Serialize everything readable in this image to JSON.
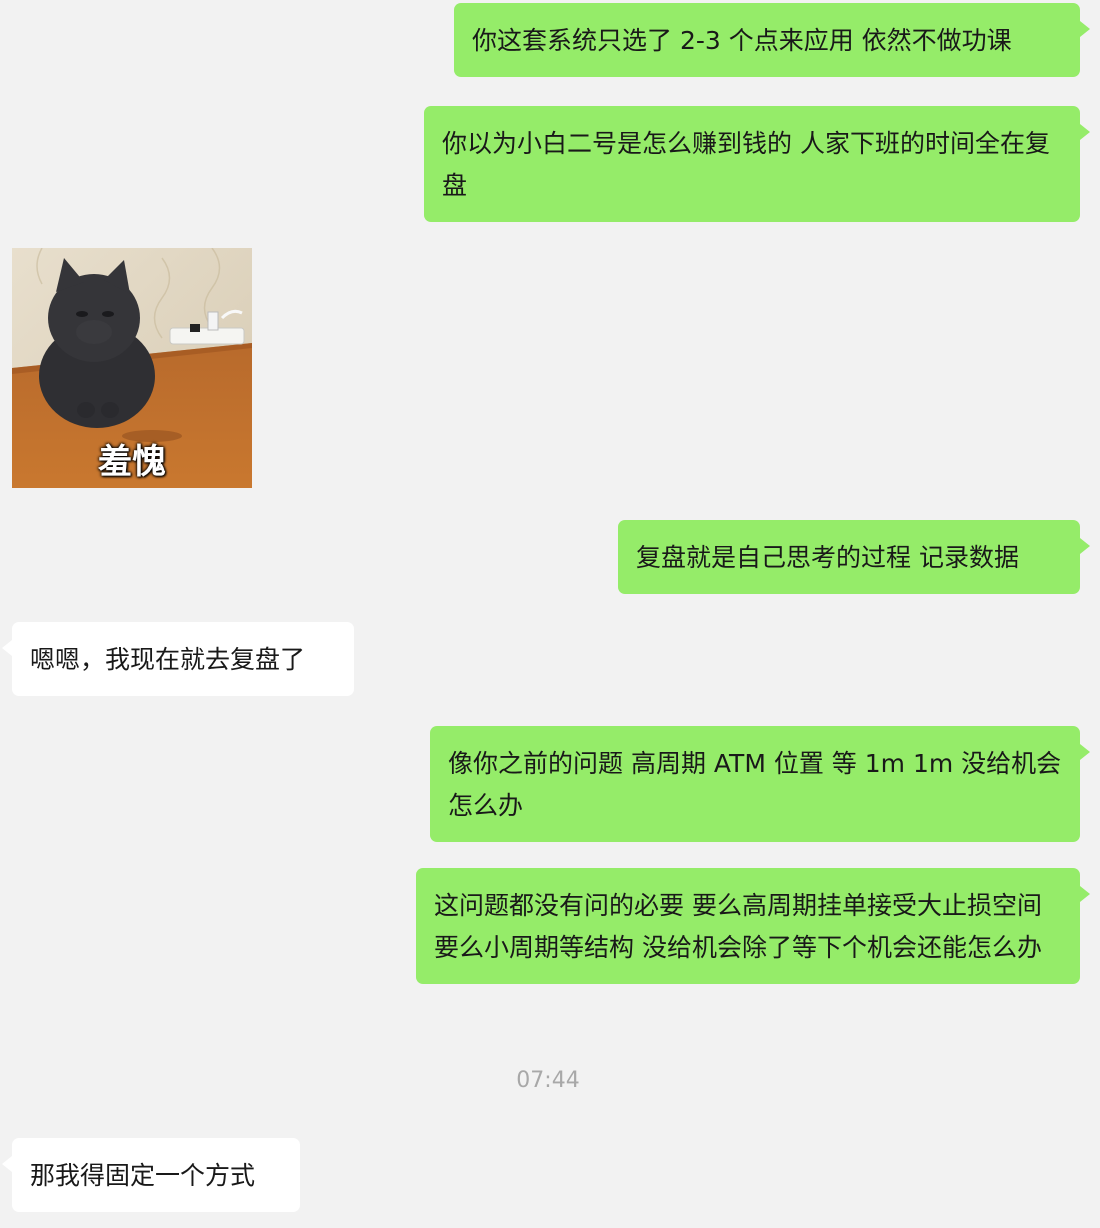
{
  "messages": [
    {
      "side": "out",
      "text": "你这套系统只选了 2-3 个点来应用 依然不做功课"
    },
    {
      "side": "out",
      "text": "你以为小白二号是怎么赚到钱的 人家下班的时间全在复盘"
    },
    {
      "side": "in",
      "sticker": {
        "caption": "羞愧",
        "icon": "black-cat-sticker"
      }
    },
    {
      "side": "out",
      "text": "复盘就是自己思考的过程 记录数据"
    },
    {
      "side": "in",
      "text": "嗯嗯，我现在就去复盘了"
    },
    {
      "side": "out",
      "text": "像你之前的问题 高周期 ATM 位置 等 1m 1m 没给机会怎么办"
    },
    {
      "side": "out",
      "text": "这问题都没有问的必要 要么高周期挂单接受大止损空间 要么小周期等结构 没给机会除了等下个机会还能怎么办"
    },
    {
      "side": "in",
      "text": "那我得固定一个方式"
    }
  ],
  "timestamp": "07:44",
  "colors": {
    "background": "#f2f2f2",
    "outgoing_bubble": "#95ec69",
    "incoming_bubble": "#ffffff",
    "timestamp_text": "#a8a8a8"
  }
}
